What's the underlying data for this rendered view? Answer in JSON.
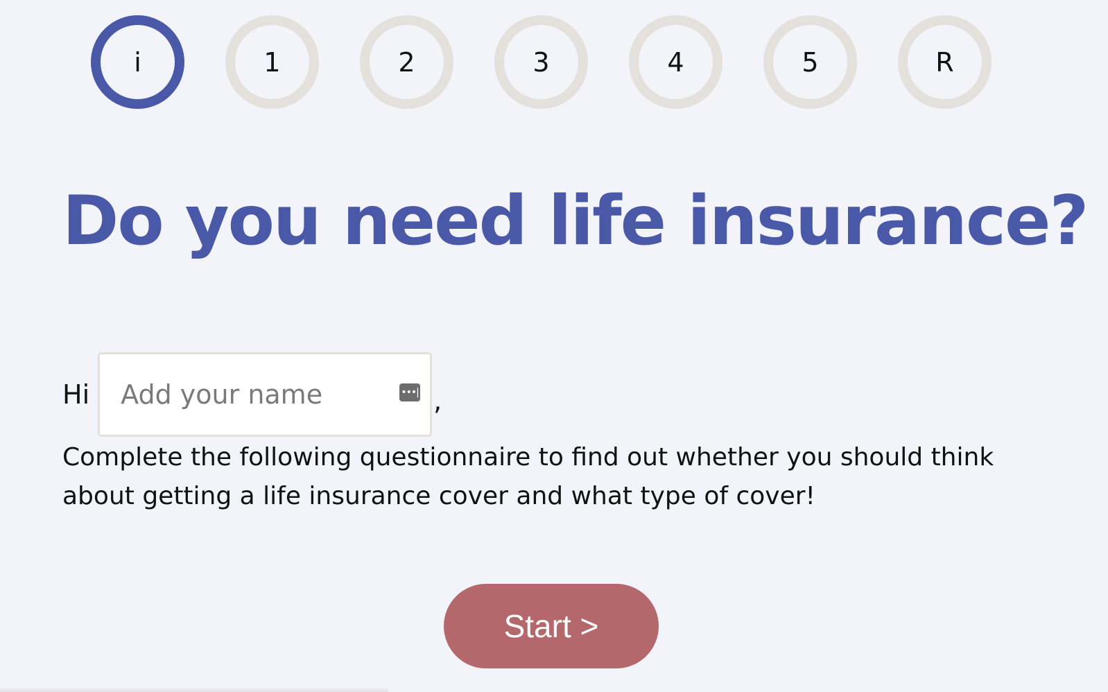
{
  "steps": [
    {
      "label": "i",
      "active": true
    },
    {
      "label": "1",
      "active": false
    },
    {
      "label": "2",
      "active": false
    },
    {
      "label": "3",
      "active": false
    },
    {
      "label": "4",
      "active": false
    },
    {
      "label": "5",
      "active": false
    },
    {
      "label": "R",
      "active": false
    }
  ],
  "title": "Do you need life insurance?",
  "greeting": {
    "hi": "Hi",
    "name_value": "",
    "name_placeholder": "Add your name",
    "comma": ","
  },
  "intro": "Complete the following questionnaire to find out whether you should think about getting a life insurance cover and what type of cover!",
  "start_label": "Start >",
  "colors": {
    "accent": "#4a58a8",
    "step_inactive": "#e4e1dc",
    "button": "#b4686c",
    "background": "#f3f4f9"
  },
  "icons": {
    "autofill": "autofill-contact-icon"
  }
}
